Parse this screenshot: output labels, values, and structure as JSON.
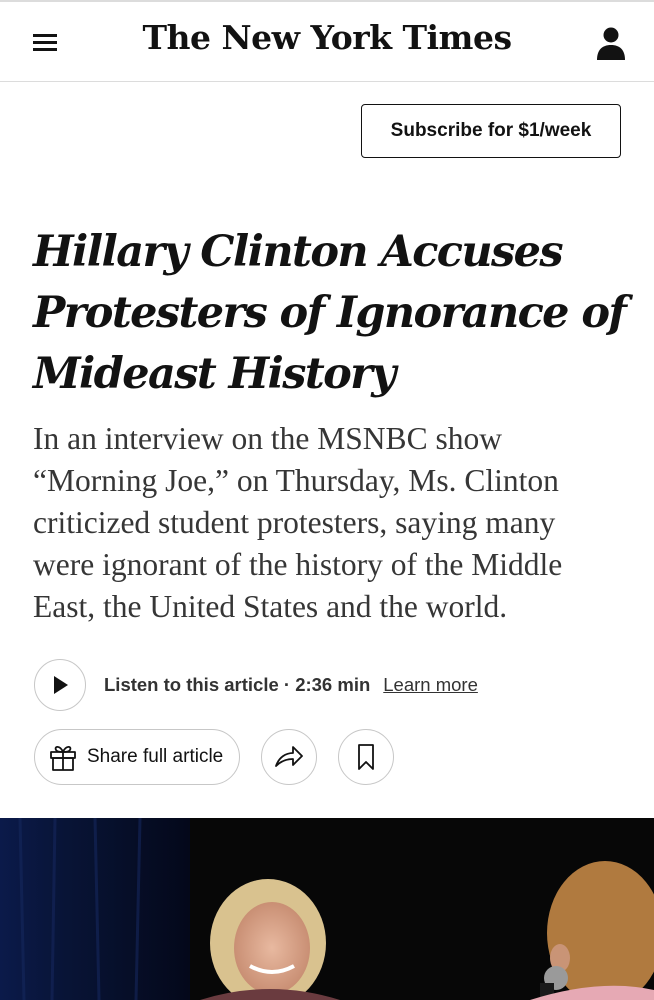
{
  "header": {
    "logo_text": "The New York Times",
    "menu_icon": "hamburger-menu-icon",
    "account_icon": "user-account-icon"
  },
  "subscribe": {
    "label": "Subscribe for $1/week"
  },
  "article": {
    "headline": "Hillary Clinton Accuses Protesters of Ignorance of Mideast History",
    "summary": "In an interview on the MSNBC show “Morning Joe,” on Thursday, Ms. Clinton criticized student protesters, saying many were ignorant of the history of the Middle East, the United States and the world."
  },
  "audio": {
    "listen_label": "Listen to this article · 2:36 min",
    "learn_more": "Learn more",
    "play_icon": "play-icon"
  },
  "share": {
    "share_full_label": "Share full article",
    "gift_icon": "gift-icon",
    "share_icon": "share-arrow-icon",
    "bookmark_icon": "bookmark-icon"
  },
  "colors": {
    "text": "#121212",
    "summary_text": "#363636",
    "border": "#c7c7c7",
    "divider": "#dcdcdc",
    "photo_background": "#0a0a0a"
  }
}
